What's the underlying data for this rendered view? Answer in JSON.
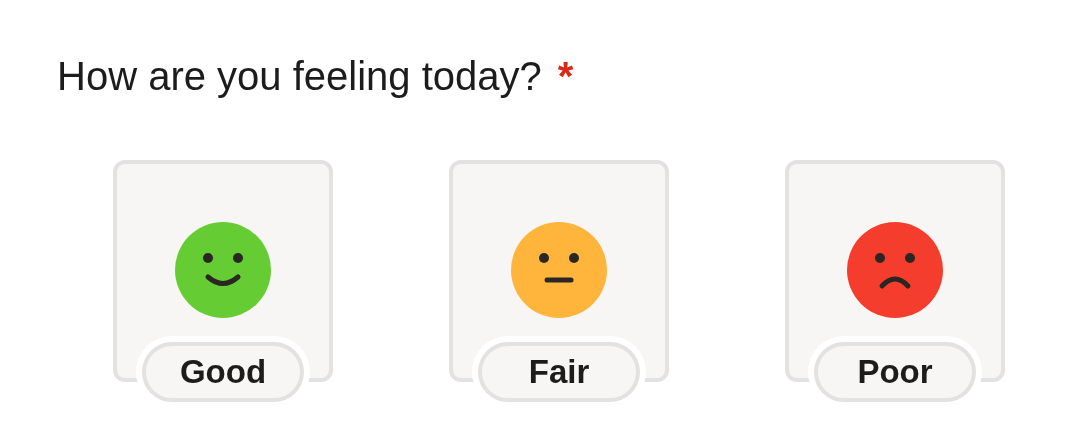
{
  "question": {
    "text": "How are you feeling today?",
    "required_mark": "*"
  },
  "options": [
    {
      "kind": "smile",
      "color": "#66cc33",
      "label": "Good",
      "selected": false
    },
    {
      "kind": "neutral",
      "color": "#ffb43c",
      "label": "Fair",
      "selected": false
    },
    {
      "kind": "frown",
      "color": "#f53d2d",
      "label": "Poor",
      "selected": false
    }
  ]
}
